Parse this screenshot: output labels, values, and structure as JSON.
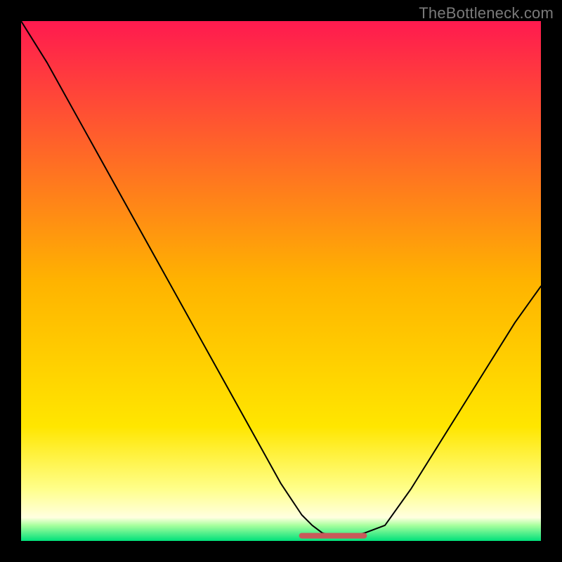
{
  "watermark": "TheBottleneck.com",
  "chart_data": {
    "type": "line",
    "title": "",
    "xlabel": "",
    "ylabel": "",
    "xlim": [
      0,
      100
    ],
    "ylim": [
      0,
      100
    ],
    "grid": false,
    "legend": false,
    "background_gradient_stops": [
      {
        "offset": 0.0,
        "color": "#ff1a4f"
      },
      {
        "offset": 0.5,
        "color": "#ffb300"
      },
      {
        "offset": 0.78,
        "color": "#ffe600"
      },
      {
        "offset": 0.9,
        "color": "#ffff8a"
      },
      {
        "offset": 0.955,
        "color": "#ffffe0"
      },
      {
        "offset": 0.97,
        "color": "#a8ff9e"
      },
      {
        "offset": 1.0,
        "color": "#00e07a"
      }
    ],
    "series": [
      {
        "name": "curve-black",
        "stroke": "#000000",
        "stroke_width": 2,
        "x": [
          0,
          5,
          10,
          15,
          20,
          25,
          30,
          35,
          40,
          45,
          50,
          52,
          54,
          56,
          58,
          60,
          62,
          64,
          66,
          70,
          75,
          80,
          85,
          90,
          95,
          100
        ],
        "y": [
          100,
          92,
          83,
          74,
          65,
          56,
          47,
          38,
          29,
          20,
          11,
          8,
          5,
          3,
          1.5,
          1,
          1,
          1,
          1.5,
          3,
          10,
          18,
          26,
          34,
          42,
          49
        ]
      },
      {
        "name": "flat-region-marker",
        "stroke": "#c85a5a",
        "stroke_width": 8,
        "x": [
          54,
          56,
          58,
          60,
          62,
          64,
          66
        ],
        "y": [
          1,
          1,
          1,
          1,
          1,
          1,
          1
        ]
      }
    ]
  }
}
